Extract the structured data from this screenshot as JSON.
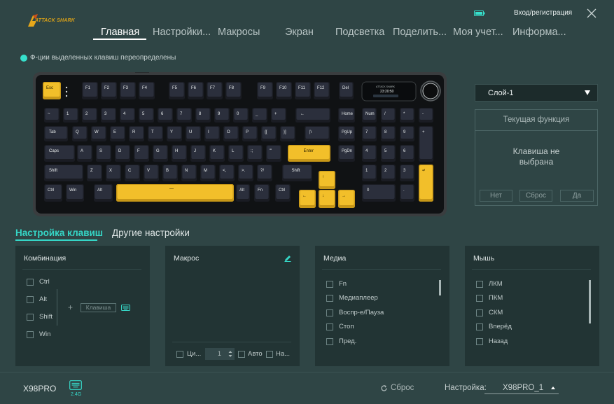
{
  "brand": {
    "logo_text": "ATTACK SHARK"
  },
  "header": {
    "login_label": "Вход/регистрация"
  },
  "nav": {
    "items": [
      "Главная",
      "Настройки...",
      "Макросы",
      "Экран",
      "Подсветка",
      "Поделить...",
      "Моя учет...",
      "Информа..."
    ],
    "active_index": 0
  },
  "notice": "Ф-ции выделенных клавиш переопределены",
  "keyboard": {
    "screen_time": "23:20:50",
    "screen_label": "ATTACK SHARK",
    "rows": [
      [
        [
          "Esc",
          "y"
        ],
        [
          "F1",
          "d"
        ],
        [
          "F2",
          "d"
        ],
        [
          "F3",
          "d"
        ],
        [
          "F4",
          "d"
        ],
        [
          "F5",
          "d"
        ],
        [
          "F6",
          "d"
        ],
        [
          "F7",
          "d"
        ],
        [
          "F8",
          "d"
        ],
        [
          "F9",
          "d"
        ],
        [
          "F10",
          "d"
        ],
        [
          "F11",
          "d"
        ],
        [
          "F12",
          "d"
        ],
        [
          "Del",
          "d"
        ]
      ],
      [
        [
          "~",
          "d"
        ],
        [
          "1",
          "d"
        ],
        [
          "2",
          "d"
        ],
        [
          "3",
          "d"
        ],
        [
          "4",
          "d"
        ],
        [
          "5",
          "d"
        ],
        [
          "6",
          "d"
        ],
        [
          "7",
          "d"
        ],
        [
          "8",
          "d"
        ],
        [
          "9",
          "d"
        ],
        [
          "0",
          "d"
        ],
        [
          "_",
          "d"
        ],
        [
          "+",
          "d"
        ],
        [
          "←",
          "d"
        ],
        [
          "Home",
          "d"
        ],
        [
          "Num",
          "d"
        ],
        [
          "/",
          "d"
        ],
        [
          "*",
          "d"
        ],
        [
          "-",
          "d"
        ]
      ],
      [
        [
          "Tab",
          "d"
        ],
        [
          "Q",
          "d"
        ],
        [
          "W",
          "d"
        ],
        [
          "E",
          "d"
        ],
        [
          "R",
          "d"
        ],
        [
          "T",
          "d"
        ],
        [
          "Y",
          "d"
        ],
        [
          "U",
          "d"
        ],
        [
          "I",
          "d"
        ],
        [
          "O",
          "d"
        ],
        [
          "P",
          "d"
        ],
        [
          "{[",
          "d"
        ],
        [
          "}]",
          "d"
        ],
        [
          "|\\",
          "d"
        ],
        [
          "PgUp",
          "d"
        ],
        [
          "7",
          "d"
        ],
        [
          "8",
          "d"
        ],
        [
          "9",
          "d"
        ],
        [
          "+",
          "d"
        ]
      ],
      [
        [
          "Caps",
          "d"
        ],
        [
          "A",
          "d"
        ],
        [
          "S",
          "d"
        ],
        [
          "D",
          "d"
        ],
        [
          "F",
          "d"
        ],
        [
          "G",
          "d"
        ],
        [
          "H",
          "d"
        ],
        [
          "J",
          "d"
        ],
        [
          "K",
          "d"
        ],
        [
          "L",
          "d"
        ],
        [
          ":;",
          "d"
        ],
        [
          "\"'",
          "d"
        ],
        [
          "Enter",
          "y"
        ],
        [
          "PgDn",
          "d"
        ],
        [
          "4",
          "d"
        ],
        [
          "5",
          "d"
        ],
        [
          "6",
          "d"
        ]
      ],
      [
        [
          "Shift",
          "d"
        ],
        [
          "Z",
          "d"
        ],
        [
          "X",
          "d"
        ],
        [
          "C",
          "d"
        ],
        [
          "V",
          "d"
        ],
        [
          "B",
          "d"
        ],
        [
          "N",
          "d"
        ],
        [
          "M",
          "d"
        ],
        [
          "<,",
          "d"
        ],
        [
          ">.",
          "d"
        ],
        [
          "?/",
          "d"
        ],
        [
          "Shift",
          "d"
        ],
        [
          "↑",
          "y"
        ],
        [
          "1",
          "d"
        ],
        [
          "2",
          "d"
        ],
        [
          "3",
          "d"
        ],
        [
          "↵",
          "y"
        ]
      ],
      [
        [
          "Ctrl",
          "d"
        ],
        [
          "Win",
          "d"
        ],
        [
          "Alt",
          "d"
        ],
        [
          "—",
          "y"
        ],
        [
          "Alt",
          "d"
        ],
        [
          "Fn",
          "d"
        ],
        [
          "Ctrl",
          "d"
        ],
        [
          "←",
          "y"
        ],
        [
          "↓",
          "y"
        ],
        [
          "→",
          "y"
        ],
        [
          "0",
          "d"
        ],
        [
          ".",
          "d"
        ]
      ]
    ]
  },
  "layer": {
    "selected": "Слой-1"
  },
  "function_panel": {
    "title": "Текущая функция",
    "body_line1": "Клавиша не",
    "body_line2": "выбрана",
    "btn_no": "Нет",
    "btn_reset": "Сброс",
    "btn_yes": "Да"
  },
  "tabs": {
    "key_settings": "Настройка клавиш",
    "other_settings": "Другие настройки"
  },
  "combo_panel": {
    "title": "Комбинация",
    "modifiers": [
      "Ctrl",
      "Alt",
      "Shift",
      "Win"
    ],
    "plus": "+",
    "key_placeholder": "Клавиша"
  },
  "macro_panel": {
    "title": "Макрос",
    "cycle_label": "Ци...",
    "cycle_value": "1",
    "auto_label": "Авто",
    "press_label": "На..."
  },
  "media_panel": {
    "title": "Медиа",
    "items": [
      "Fn",
      "Медиаплеер",
      "Воспр-е/Пауза",
      "Стоп",
      "Пред."
    ]
  },
  "mouse_panel": {
    "title": "Мышь",
    "items": [
      "ЛКМ",
      "ПКМ",
      "СКМ",
      "Вперёд",
      "Назад"
    ]
  },
  "footer": {
    "model": "X98PRO",
    "connection": "2.4G",
    "reset_label": "Сброс",
    "preset_label": "Настройка:",
    "preset_value": "X98PRO_1"
  },
  "colors": {
    "accent": "#35d6c6",
    "key_yellow": "#f2bf2a",
    "key_dark": "#2b2f3c"
  }
}
